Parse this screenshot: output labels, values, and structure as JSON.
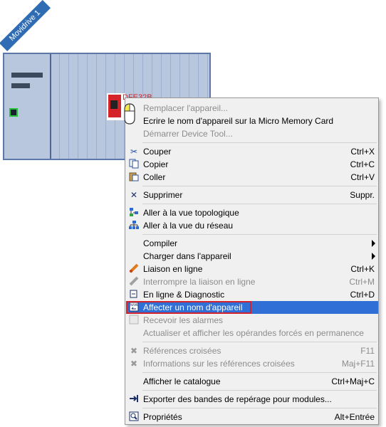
{
  "device": {
    "tag": "Movidrive 1",
    "module_label": "DFE32B"
  },
  "menu": {
    "items": [
      {
        "label": "Remplacer l'appareil...",
        "shortcut": "",
        "disabled": true,
        "icon": ""
      },
      {
        "label": "Ecrire le nom d'appareil sur la Micro Memory Card",
        "shortcut": "",
        "disabled": false,
        "icon": ""
      },
      {
        "label": "Démarrer Device Tool...",
        "shortcut": "",
        "disabled": true,
        "icon": ""
      },
      {
        "label": "Couper",
        "shortcut": "Ctrl+X",
        "disabled": false,
        "icon": "scissors-icon"
      },
      {
        "label": "Copier",
        "shortcut": "Ctrl+C",
        "disabled": false,
        "icon": "copy-icon"
      },
      {
        "label": "Coller",
        "shortcut": "Ctrl+V",
        "disabled": false,
        "icon": "paste-icon"
      },
      {
        "label": "Supprimer",
        "shortcut": "Suppr.",
        "disabled": false,
        "icon": "delete-icon"
      },
      {
        "label": "Aller à la vue topologique",
        "shortcut": "",
        "disabled": false,
        "icon": "topology-icon"
      },
      {
        "label": "Aller à la vue du réseau",
        "shortcut": "",
        "disabled": false,
        "icon": "network-icon"
      },
      {
        "label": "Compiler",
        "shortcut": "",
        "disabled": false,
        "icon": "",
        "submenu": true
      },
      {
        "label": "Charger dans l'appareil",
        "shortcut": "",
        "disabled": false,
        "icon": "",
        "submenu": true
      },
      {
        "label": "Liaison en ligne",
        "shortcut": "Ctrl+K",
        "disabled": false,
        "icon": "online-icon"
      },
      {
        "label": "Interrompre la liaison en ligne",
        "shortcut": "Ctrl+M",
        "disabled": true,
        "icon": "offline-icon"
      },
      {
        "label": "En ligne & Diagnostic",
        "shortcut": "Ctrl+D",
        "disabled": false,
        "icon": "diagnostic-icon"
      },
      {
        "label": "Affecter un nom d'appareil",
        "shortcut": "",
        "disabled": false,
        "icon": "assign-name-icon",
        "highlighted": true
      },
      {
        "label": "Recevoir les alarmes",
        "shortcut": "",
        "disabled": true,
        "icon": "checkbox-icon"
      },
      {
        "label": "Actualiser et afficher les opérandes forcés en permanence",
        "shortcut": "",
        "disabled": true,
        "icon": ""
      },
      {
        "label": "Références croisées",
        "shortcut": "F11",
        "disabled": true,
        "icon": "crossref-icon"
      },
      {
        "label": "Informations sur les références croisées",
        "shortcut": "Maj+F11",
        "disabled": true,
        "icon": "crossref-info-icon"
      },
      {
        "label": "Afficher le catalogue",
        "shortcut": "Ctrl+Maj+C",
        "disabled": false,
        "icon": ""
      },
      {
        "label": "Exporter des bandes de repérage pour modules...",
        "shortcut": "",
        "disabled": false,
        "icon": "export-icon"
      },
      {
        "label": "Propriétés",
        "shortcut": "Alt+Entrée",
        "disabled": false,
        "icon": "properties-icon"
      }
    ]
  }
}
